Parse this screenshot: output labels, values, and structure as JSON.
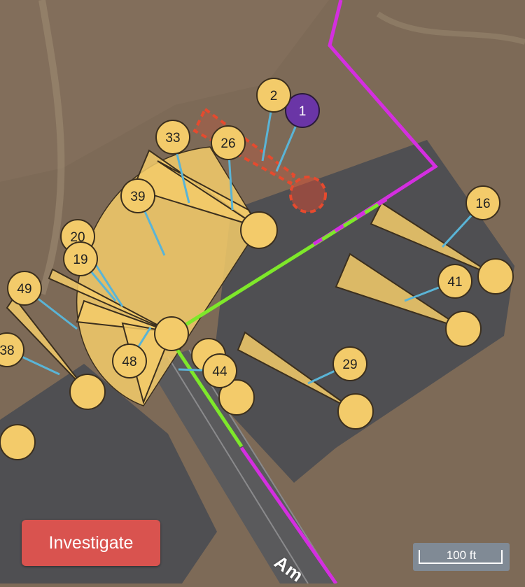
{
  "map": {
    "colors": {
      "terrain": "#7d6a57",
      "parking_lot": "#4f4f52",
      "road": "#5a5a5c",
      "camera_fill": "#f3cb6a",
      "camera_stroke": "#3b2f1e",
      "leader_line": "#5ab4d6",
      "boundary_magenta": "#d42ee0",
      "path_green": "#7ee82a",
      "selected_area": "#e64a2e",
      "incident_marker": "#6a35a6"
    },
    "road_label": "Am",
    "markers": [
      {
        "id": "m1",
        "label": "1",
        "kind": "incident"
      },
      {
        "id": "m2",
        "label": "2"
      },
      {
        "id": "m33",
        "label": "33"
      },
      {
        "id": "m26",
        "label": "26"
      },
      {
        "id": "m39",
        "label": "39"
      },
      {
        "id": "m16",
        "label": "16"
      },
      {
        "id": "m20",
        "label": "20"
      },
      {
        "id": "m19",
        "label": "19"
      },
      {
        "id": "m41",
        "label": "41"
      },
      {
        "id": "m49",
        "label": "49"
      },
      {
        "id": "m38",
        "label": "38"
      },
      {
        "id": "m48",
        "label": "48"
      },
      {
        "id": "m44",
        "label": "44"
      },
      {
        "id": "m29",
        "label": "29"
      }
    ]
  },
  "actions": {
    "investigate_label": "Investigate"
  },
  "scale": {
    "label": "100 ft"
  }
}
